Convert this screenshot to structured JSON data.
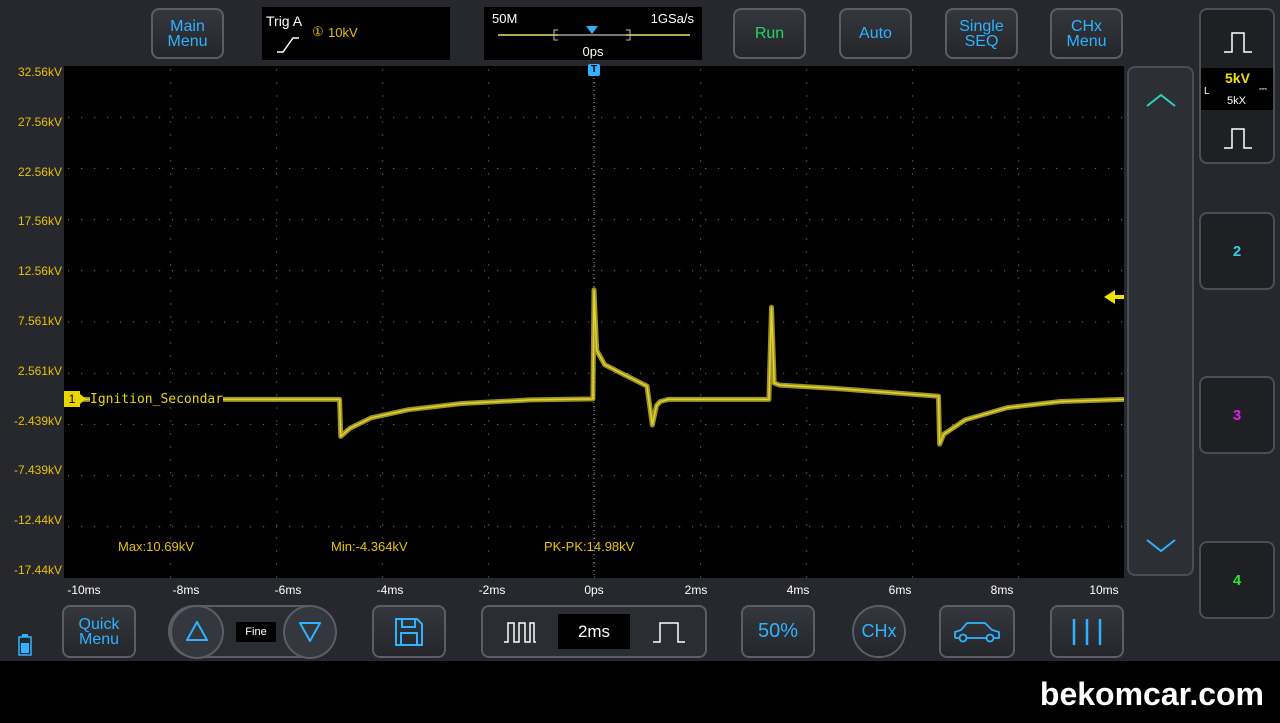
{
  "top": {
    "main_menu": "Main\nMenu",
    "trigger": {
      "label": "Trig A",
      "source": "①",
      "level": "10kV"
    },
    "timebase": {
      "memory": "50M",
      "sample_rate": "1GSa/s",
      "delay": "0ps"
    },
    "run": "Run",
    "auto": "Auto",
    "single": "Single\nSEQ",
    "chx_menu": "CHx\nMenu"
  },
  "scope": {
    "y_labels": [
      "32.56kV",
      "27.56kV",
      "22.56kV",
      "17.56kV",
      "12.56kV",
      "7.561kV",
      "2.561kV",
      "-2.439kV",
      "-7.439kV",
      "-12.44kV",
      "-17.44kV"
    ],
    "x_labels": [
      "-10ms",
      "-8ms",
      "-6ms",
      "-4ms",
      "-2ms",
      "0ps",
      "2ms",
      "4ms",
      "6ms",
      "8ms",
      "10ms"
    ],
    "channel_marker": "1",
    "channel_name": "Ignition_Secondar",
    "measurements": {
      "max": "Max:10.69kV",
      "min": "Min:-4.364kV",
      "pkpk": "PK-PK:14.98kV"
    },
    "trigger_marker": "T"
  },
  "chart_data": {
    "type": "line",
    "x_unit": "ms",
    "y_unit": "kV",
    "xlim": [
      -10,
      10
    ],
    "ylim": [
      -17.44,
      32.56
    ],
    "series": [
      {
        "color": "#d4c52a",
        "x": [
          -10,
          -4.8,
          -4.78,
          -4.6,
          -4.2,
          -3.5,
          -2.5,
          -1.2,
          -0.02,
          0.0,
          0.05,
          0.2,
          0.5,
          1.0,
          1.1,
          1.18,
          1.25,
          1.4,
          2.5,
          3.3,
          3.35,
          3.4,
          3.5,
          4.5,
          5.5,
          6.5,
          6.52,
          6.6,
          7.0,
          7.8,
          8.8,
          10
        ],
        "y": [
          0.0,
          0.0,
          -3.6,
          -2.8,
          -1.8,
          -1.0,
          -0.4,
          -0.05,
          0.05,
          10.69,
          4.8,
          3.4,
          2.6,
          1.3,
          -2.5,
          -0.6,
          -0.2,
          0.0,
          0.0,
          0.0,
          9.0,
          1.6,
          1.4,
          1.1,
          0.7,
          0.3,
          -4.364,
          -3.4,
          -2.0,
          -0.8,
          -0.2,
          0.0
        ]
      }
    ]
  },
  "bottom": {
    "quick_menu": "Quick\nMenu",
    "fine": "Fine",
    "timebase_value": "2ms",
    "fifty": "50%",
    "chx": "CHx"
  },
  "right": {
    "volts": "5kV",
    "coupling": "L",
    "probe": "5kX",
    "ch2": "2",
    "ch3": "3",
    "ch4": "4"
  },
  "watermark": "bekomcar.com"
}
